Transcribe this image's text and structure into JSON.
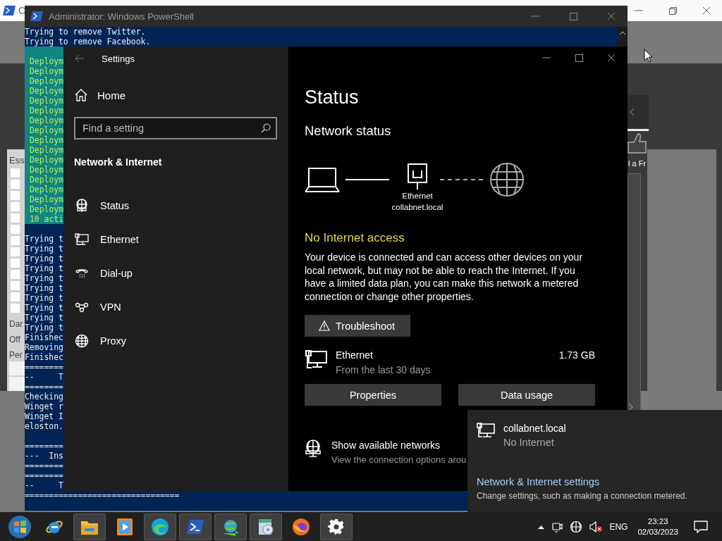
{
  "background_window": {
    "title": "C",
    "heading": "Ess",
    "checkboxes": [
      {
        "checked": false
      },
      {
        "checked": false
      },
      {
        "checked": false
      },
      {
        "checked": false
      },
      {
        "checked": false
      },
      {
        "checked": false
      },
      {
        "checked": false
      },
      {
        "checked": false
      },
      {
        "checked": false
      },
      {
        "checked": false
      },
      {
        "checked": false
      },
      {
        "checked": false
      },
      {
        "checked": false
      }
    ],
    "labels": [
      "Dar",
      "Off",
      "Per"
    ],
    "side_label": "l a Fr"
  },
  "powershell": {
    "title": "Administrator: Windows PowerShell",
    "lines": [
      {
        "kind": "normal",
        "text": "Trying to remove Twitter."
      },
      {
        "kind": "normal",
        "text": "Trying to remove Facebook."
      },
      {
        "kind": "deploy"
      },
      {
        "kind": "deploy",
        "text": "Deploym"
      },
      {
        "kind": "deploy",
        "text": "Deploym"
      },
      {
        "kind": "deploy",
        "text": "Deploym"
      },
      {
        "kind": "deploy",
        "text": "Deploym"
      },
      {
        "kind": "deploy",
        "text": "Deploym"
      },
      {
        "kind": "deploy",
        "text": "Deploym"
      },
      {
        "kind": "deploy",
        "text": "Deploym"
      },
      {
        "kind": "deploy",
        "text": "Deploym"
      },
      {
        "kind": "deploy",
        "text": "Deploym"
      },
      {
        "kind": "deploy",
        "text": "Deploym"
      },
      {
        "kind": "deploy",
        "text": "Deploym"
      },
      {
        "kind": "deploy",
        "text": "Deploym"
      },
      {
        "kind": "deploy",
        "text": "Deploym"
      },
      {
        "kind": "deploy",
        "text": "Deploym"
      },
      {
        "kind": "deploy",
        "text": "Deploym"
      },
      {
        "kind": "deploy",
        "text": "Deploym"
      },
      {
        "kind": "deploy",
        "text": "10 acti"
      },
      {
        "kind": "normal"
      },
      {
        "kind": "normal",
        "text": "Trying t"
      },
      {
        "kind": "normal",
        "text": "Trying t"
      },
      {
        "kind": "normal",
        "text": "Trying t"
      },
      {
        "kind": "normal",
        "text": "Trying t"
      },
      {
        "kind": "normal",
        "text": "Trying t"
      },
      {
        "kind": "normal",
        "text": "Trying t"
      },
      {
        "kind": "normal",
        "text": "Trying t"
      },
      {
        "kind": "normal",
        "text": "Trying t"
      },
      {
        "kind": "normal",
        "text": "Trying t"
      },
      {
        "kind": "normal",
        "text": "Trying t"
      },
      {
        "kind": "normal",
        "text": "Finishec"
      },
      {
        "kind": "normal",
        "text": "Removing"
      },
      {
        "kind": "normal",
        "text": "Finishec"
      },
      {
        "kind": "normal",
        "text": "========"
      },
      {
        "kind": "normal",
        "text": "--     T"
      },
      {
        "kind": "normal",
        "text": "========"
      },
      {
        "kind": "normal",
        "text": "Checking"
      },
      {
        "kind": "normal",
        "text": "Winget r"
      },
      {
        "kind": "normal",
        "text": "Winget I"
      },
      {
        "kind": "normal",
        "text": "eloston."
      },
      {
        "kind": "normal"
      },
      {
        "kind": "normal",
        "text": "========"
      },
      {
        "kind": "normal",
        "text": "---  Ins"
      },
      {
        "kind": "normal",
        "text": "========"
      },
      {
        "kind": "normal",
        "text": "========"
      },
      {
        "kind": "normal",
        "text": "--     T"
      },
      {
        "kind": "normal",
        "text": "================================"
      }
    ]
  },
  "settings": {
    "title": "Settings",
    "home": "Home",
    "search_placeholder": "Find a setting",
    "section": "Network & Internet",
    "nav": [
      {
        "kind": "status",
        "label": "Status"
      },
      {
        "kind": "ethernet",
        "label": "Ethernet"
      },
      {
        "kind": "dialup",
        "label": "Dial-up"
      },
      {
        "kind": "vpn",
        "label": "VPN"
      },
      {
        "kind": "proxy",
        "label": "Proxy"
      }
    ],
    "heading": "Status",
    "subheading": "Network status",
    "diagram": {
      "adapter": "Ethernet",
      "network": "collabnet.local"
    },
    "alert": "No Internet access",
    "description": "Your device is connected and can access other devices on your local network, but may not be able to reach the Internet. If you have a limited data plan, you can make this network a metered connection or change other properties.",
    "troubleshoot": "Troubleshoot",
    "usage": {
      "name": "Ethernet",
      "period": "From the last 30 days",
      "amount": "1.73 GB"
    },
    "buttons": [
      "Properties",
      "Data usage"
    ],
    "networks_link": {
      "title": "Show available networks",
      "subtitle": "View the connection options arou"
    }
  },
  "flyout": {
    "network": "collabnet.local",
    "status": "No Internet",
    "settings_link": "Network & Internet settings",
    "settings_hint": "Change settings, such as making a connection metered."
  },
  "taskbar": {
    "apps": [
      {
        "kind": "ie",
        "open": false
      },
      {
        "kind": "explorer",
        "open": true
      },
      {
        "kind": "media",
        "open": false
      },
      {
        "kind": "edge",
        "open": true
      },
      {
        "kind": "powershell",
        "open": true
      },
      {
        "kind": "network",
        "open": true
      },
      {
        "kind": "installer",
        "open": true
      },
      {
        "kind": "firefox",
        "open": false
      },
      {
        "kind": "settings",
        "open": true
      }
    ],
    "language": "ENG",
    "time": "23:23",
    "date": "02/03/2023"
  }
}
